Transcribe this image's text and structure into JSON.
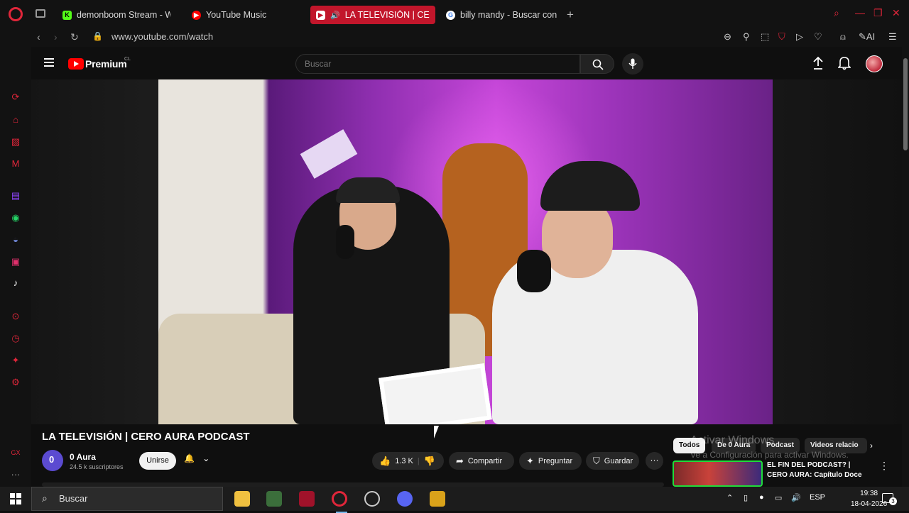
{
  "browser": {
    "tabs": [
      {
        "label": "demonboom Stream - Wat",
        "icon": "kick-icon",
        "color": "#53fc18"
      },
      {
        "label": "YouTube Music",
        "icon": "youtube-music-icon",
        "color": "#ff0000"
      },
      {
        "label": "LA TELEVISIÓN | CERO",
        "icon": "youtube-icon",
        "color": "#ff0000",
        "active": true
      },
      {
        "label": "billy mandy - Buscar con G",
        "icon": "google-icon",
        "color": "#4285f4"
      }
    ],
    "new_tab": "+",
    "url": "www.youtube.com/watch",
    "ai_label": "AI",
    "accent": "#e0263a"
  },
  "youtube": {
    "brand": "Premium",
    "region": "CL",
    "search_placeholder": "Buscar",
    "video_title": "LA TELEVISIÓN | CERO AURA PODCAST",
    "channel": {
      "name": "0 Aura",
      "subscribers": "24.5 k suscriptores"
    },
    "join_label": "Unirse",
    "likes": "1.3 K",
    "share_label": "Compartir",
    "ask_label": "Preguntar",
    "save_label": "Guardar",
    "chips": [
      "Todos",
      "De 0 Aura",
      "Podcast",
      "Videos relacio"
    ],
    "recommendation": {
      "title": "EL FIN DEL PODCAST? | CERO AURA: Capítulo Doce"
    }
  },
  "windows": {
    "watermark_title": "Activar Windows",
    "watermark_text": "Ve a Configuración para activar Windows.",
    "taskbar_search": "Buscar",
    "language": "ESP",
    "time": "19:38",
    "date": "18-04-2026",
    "notification_count": "3"
  }
}
